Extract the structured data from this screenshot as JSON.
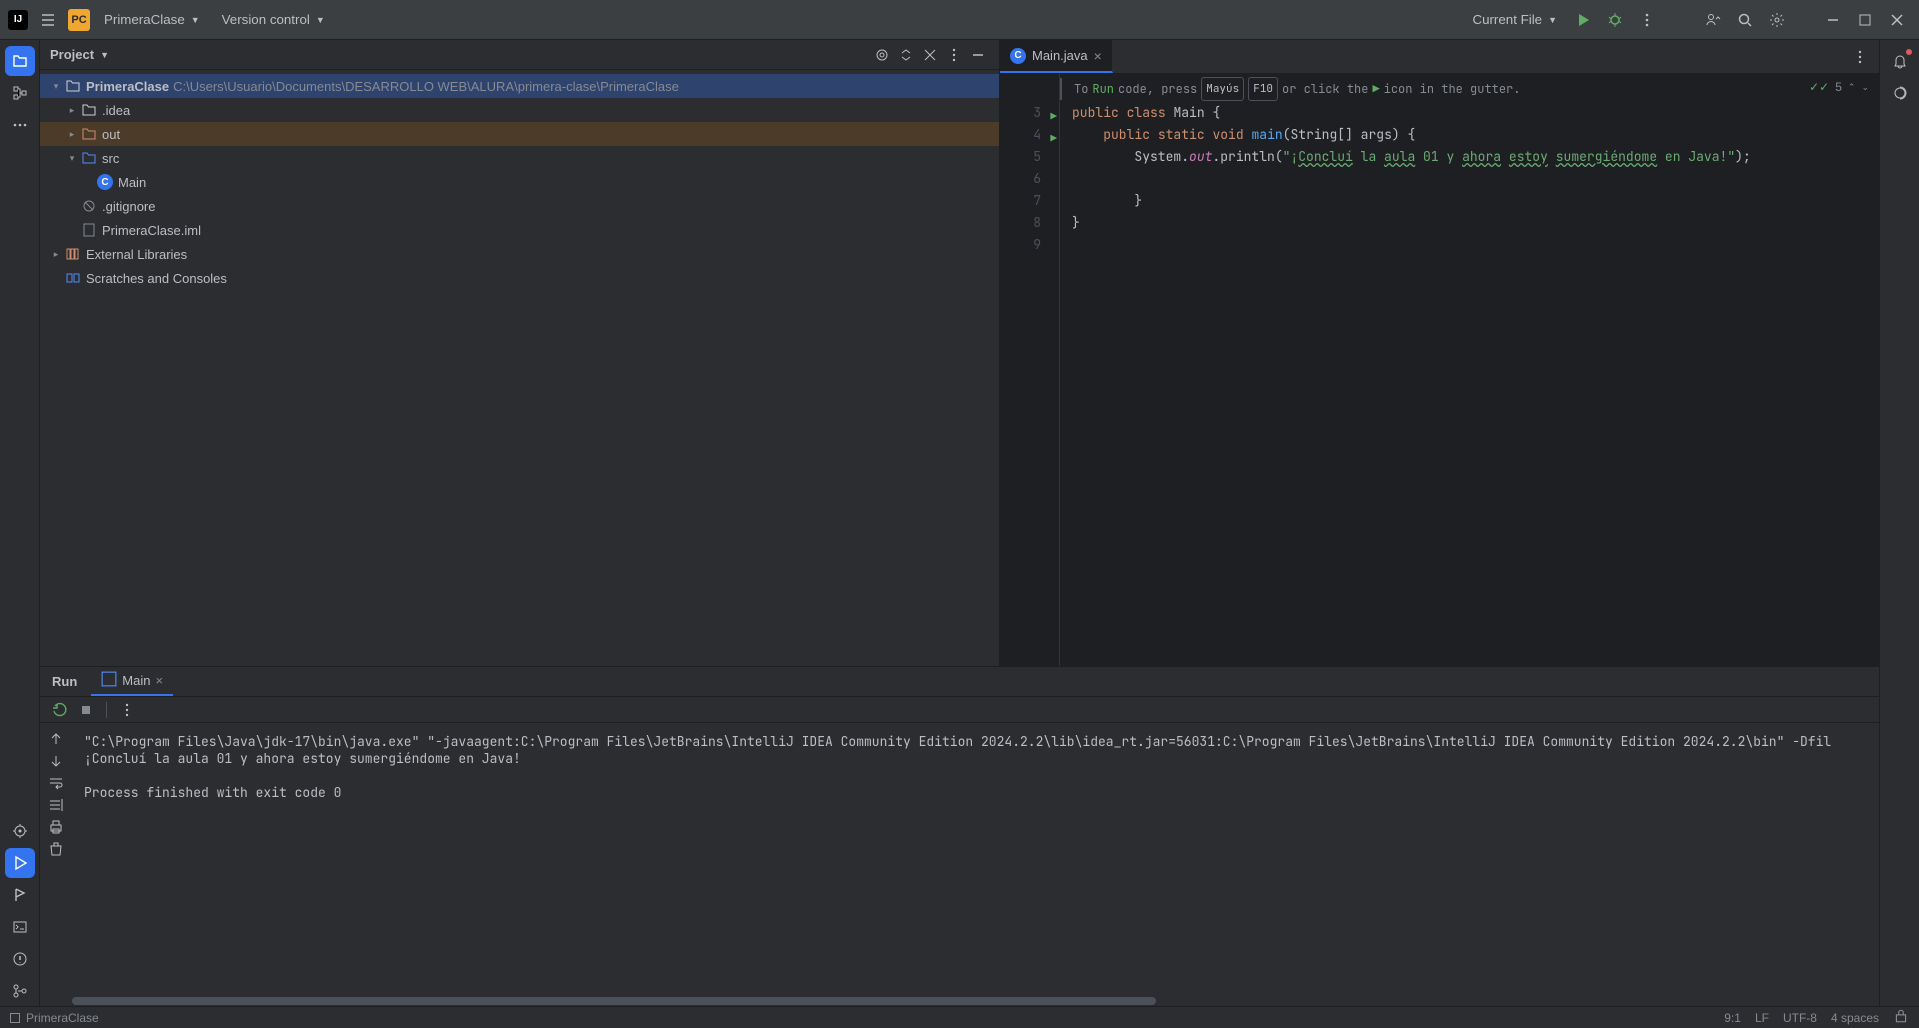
{
  "titlebar": {
    "logo_letter": "IJ",
    "pc_badge": "PC",
    "project_name": "PrimeraClase",
    "vcs_label": "Version control",
    "current_file": "Current File"
  },
  "left_rail": {
    "project": "project",
    "structure": "structure",
    "bookmarks": "bookmarks",
    "more": "more",
    "search": "search",
    "run": "run",
    "build": "build",
    "terminal": "terminal",
    "problems": "problems",
    "vcs": "vcs"
  },
  "project_panel": {
    "title": "Project",
    "root_name": "PrimeraClase",
    "root_path": "C:\\Users\\Usuario\\Documents\\DESARROLLO WEB\\ALURA\\primera-clase\\PrimeraClase",
    "items": {
      "idea": ".idea",
      "out": "out",
      "src": "src",
      "main": "Main",
      "gitignore": ".gitignore",
      "iml": "PrimeraClase.iml",
      "ext_libs": "External Libraries",
      "scratches": "Scratches and Consoles"
    }
  },
  "editor": {
    "tab_name": "Main.java",
    "hint": {
      "pre": "To ",
      "run": "Run",
      "mid": " code, press ",
      "k1": "Mayús",
      "k2": "F10",
      "post": " or click the ",
      "post2": " icon in the gutter."
    },
    "status_count": "5",
    "gutter": [
      "3",
      "4",
      "5",
      "6",
      "7",
      "8",
      "9"
    ],
    "code": {
      "l3_a": "public",
      "l3_b": "class",
      "l3_c": "Main",
      "l3_d": " {",
      "l4_a": "    public",
      "l4_b": "static",
      "l4_c": "void",
      "l4_d": "main",
      "l4_e": "(String[] args) {",
      "l5_a": "        System.",
      "l5_b": "out",
      "l5_c": ".println(",
      "l5_d": "\"¡",
      "l5_e": "Concluí",
      "l5_f": " la ",
      "l5_g": "aula",
      "l5_h": " 01 y ",
      "l5_i": "ahora",
      "l5_j": " ",
      "l5_k": "estoy",
      "l5_l": " ",
      "l5_m": "sumergiéndome",
      "l5_n": " en Java!\"",
      "l5_o": ");",
      "l7": "        }",
      "l8": "}"
    }
  },
  "run_panel": {
    "title": "Run",
    "tab": "Main",
    "console_line1": "\"C:\\Program Files\\Java\\jdk-17\\bin\\java.exe\" \"-javaagent:C:\\Program Files\\JetBrains\\IntelliJ IDEA Community Edition 2024.2.2\\lib\\idea_rt.jar=56031:C:\\Program Files\\JetBrains\\IntelliJ IDEA Community Edition 2024.2.2\\bin\" -Dfil",
    "console_line2": "¡Concluí la aula 01 y ahora estoy sumergiéndome en Java!",
    "console_line3": "",
    "console_line4": "Process finished with exit code 0"
  },
  "statusbar": {
    "module": "PrimeraClase",
    "pos": "9:1",
    "sep": "LF",
    "enc": "UTF-8",
    "indent": "4 spaces"
  }
}
